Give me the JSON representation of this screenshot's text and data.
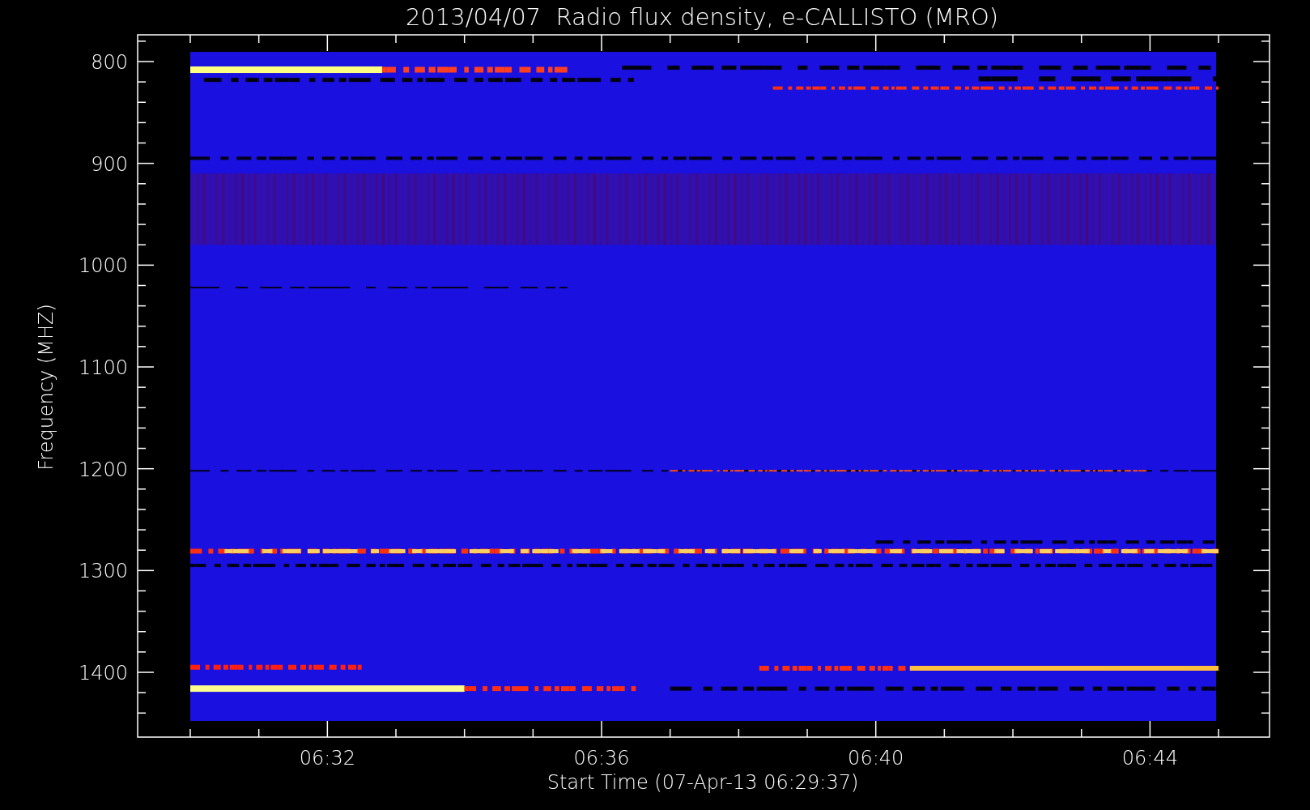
{
  "title": "2013/04/07  Radio flux density, e-CALLISTO (MRO)",
  "y_axis": {
    "label": "Frequency (MHZ)",
    "ticks": [
      "800",
      "900",
      "1000",
      "1100",
      "1200",
      "1300",
      "1400"
    ]
  },
  "x_axis": {
    "label": "Start Time (07-Apr-13 06:29:37)",
    "ticks": [
      "06:32",
      "06:36",
      "06:40",
      "06:44"
    ]
  }
}
